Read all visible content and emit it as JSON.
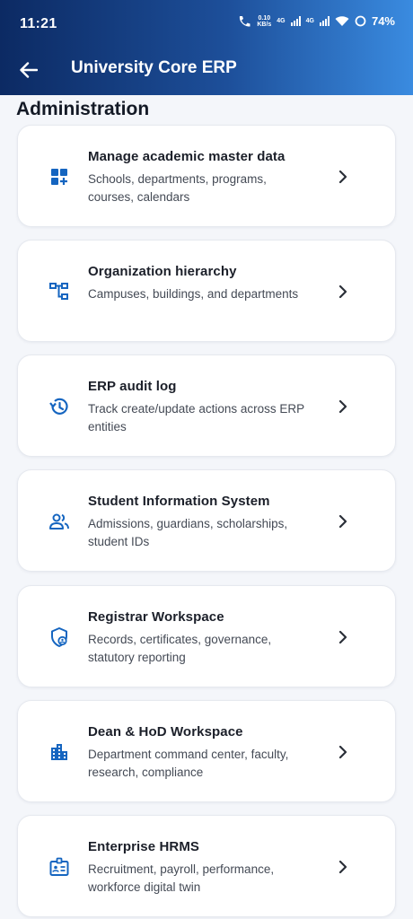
{
  "status": {
    "time": "11:21",
    "net_speed": "0.10",
    "net_unit": "KB/s",
    "net_type_1": "4G",
    "net_type_2": "4G",
    "battery": "74%"
  },
  "appbar": {
    "title": "University Core ERP",
    "back_icon": "arrow-left-icon"
  },
  "section": {
    "title": "Administration"
  },
  "items": [
    {
      "title": "Manage academic master data",
      "subtitle": "Schools, departments, programs, courses, calendars",
      "icon": "dashboard-add-icon"
    },
    {
      "title": "Organization hierarchy",
      "subtitle": "Campuses, buildings, and departments",
      "icon": "account-tree-icon"
    },
    {
      "title": "ERP audit log",
      "subtitle": "Track create/update actions across ERP entities",
      "icon": "history-icon"
    },
    {
      "title": "Student Information System",
      "subtitle": "Admissions, guardians, scholarships, student IDs",
      "icon": "people-icon"
    },
    {
      "title": "Registrar Workspace",
      "subtitle": "Records, certificates, governance, statutory reporting",
      "icon": "shield-person-icon"
    },
    {
      "title": "Dean & HoD Workspace",
      "subtitle": "Department command center, faculty, research, compliance",
      "icon": "apartment-icon"
    },
    {
      "title": "Enterprise HRMS",
      "subtitle": "Recruitment, payroll, performance, workforce digital twin",
      "icon": "badge-icon"
    }
  ],
  "colors": {
    "accent": "#1565c0",
    "header_start": "#0c2a63",
    "header_end": "#3a8be0",
    "background": "#f4f6fa"
  }
}
